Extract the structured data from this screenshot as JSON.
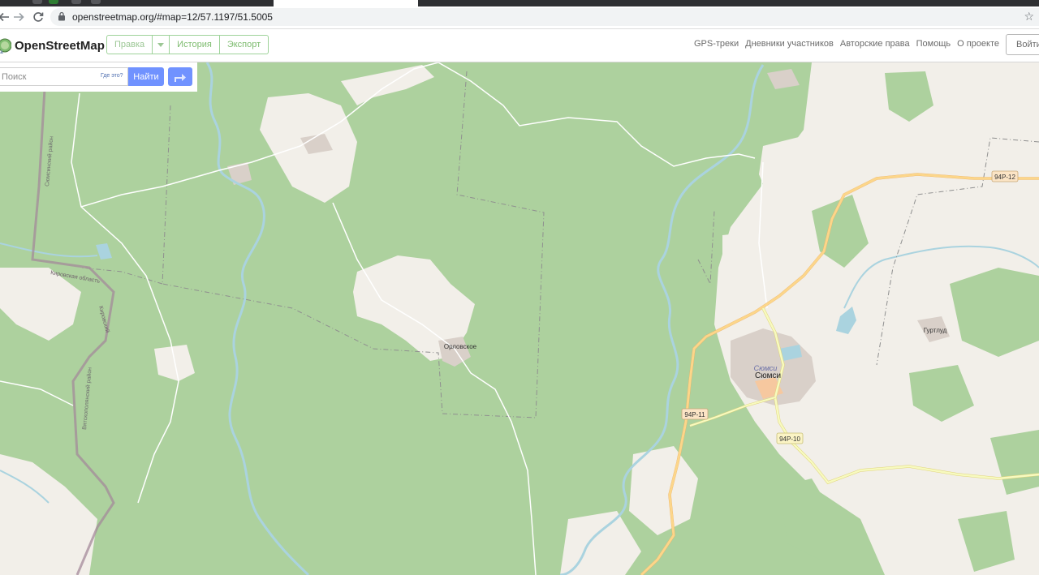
{
  "browser": {
    "url": "openstreetmap.org/#map=12/57.1197/51.5005"
  },
  "header": {
    "logo_text": "OpenStreetMap",
    "edit_label": "Правка",
    "history_label": "История",
    "export_label": "Экспорт",
    "nav": {
      "gps": "GPS-треки",
      "diaries": "Дневники участников",
      "copyright": "Авторские права",
      "help": "Помощь",
      "about": "О проекте"
    },
    "login_label": "Войти"
  },
  "search": {
    "placeholder": "Поиск",
    "where_label": "Где это?",
    "go_label": "Найти"
  },
  "map": {
    "places": {
      "orlovskoye": "Орловское",
      "syumsi_small": "Сюмси",
      "syumsi": "Сюмси",
      "gurtlud": "Гуртлуд"
    },
    "shields": {
      "r12": "94Р-12",
      "r11": "94Р-11",
      "r10": "94Р-10"
    },
    "border_labels": {
      "oblast": "Кировская область",
      "kirov_district": "Кировский",
      "district_left": "Сюмсинский район",
      "district_bottom": "Вятскополянский район"
    }
  }
}
